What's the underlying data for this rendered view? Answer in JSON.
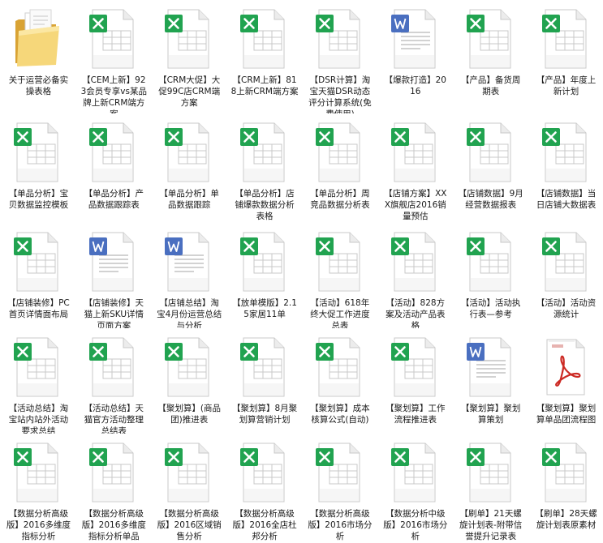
{
  "colors": {
    "excel_green": "#21a350",
    "word_blue": "#4a6fc0",
    "pdf_red": "#cc2a24",
    "page_fill": "#f2f2f2"
  },
  "files": [
    {
      "type": "folder",
      "icon": "folder-icon",
      "name": "关于运营必备实操表格"
    },
    {
      "type": "excel",
      "icon": "excel-icon",
      "name": "【CEM上新】923会员专享vs某品牌上新CRM端方案"
    },
    {
      "type": "excel",
      "icon": "excel-icon",
      "name": "【CRM大促】大促99C店CRM端方案"
    },
    {
      "type": "excel",
      "icon": "excel-icon",
      "name": "【CRM上新】818上新CRM端方案"
    },
    {
      "type": "excel",
      "icon": "excel-icon",
      "name": "【DSR计算】淘宝天猫DSR动态评分计算系统(免费使用)"
    },
    {
      "type": "word",
      "icon": "word-icon",
      "name": "【爆款打造】2016"
    },
    {
      "type": "excel",
      "icon": "excel-icon",
      "name": "【产品】备货周期表"
    },
    {
      "type": "excel",
      "icon": "excel-icon",
      "name": "【产品】年度上新计划"
    },
    {
      "type": "excel",
      "icon": "excel-icon",
      "name": "【单品分析】宝贝数据监控模板"
    },
    {
      "type": "excel",
      "icon": "excel-icon",
      "name": "【单品分析】产品数据跟踪表"
    },
    {
      "type": "excel",
      "icon": "excel-icon",
      "name": "【单品分析】单品数据跟踪"
    },
    {
      "type": "excel",
      "icon": "excel-icon",
      "name": "【单品分析】店铺爆款数据分析表格"
    },
    {
      "type": "excel",
      "icon": "excel-icon",
      "name": "【单品分析】周竞品数据分析表"
    },
    {
      "type": "excel",
      "icon": "excel-icon",
      "name": "【店铺方案】XXX旗舰店2016销量预估"
    },
    {
      "type": "excel",
      "icon": "excel-icon",
      "name": "【店铺数据】9月经营数据报表"
    },
    {
      "type": "excel",
      "icon": "excel-icon",
      "name": "【店铺数据】当日店铺大数据表"
    },
    {
      "type": "excel",
      "icon": "excel-icon",
      "name": "【店铺装修】PC首页详情面布局"
    },
    {
      "type": "word",
      "icon": "word-icon",
      "name": "【店铺装修】天猫上新SKU详情页面方案"
    },
    {
      "type": "word",
      "icon": "word-icon",
      "name": "【店铺总结】淘宝4月份运营总结与分析"
    },
    {
      "type": "excel",
      "icon": "excel-icon",
      "name": "【放单模版】2.15家居11单"
    },
    {
      "type": "excel",
      "icon": "excel-icon",
      "name": "【活动】618年终大促工作进度总表"
    },
    {
      "type": "excel",
      "icon": "excel-icon",
      "name": "【活动】828方案及活动产品表格"
    },
    {
      "type": "excel",
      "icon": "excel-icon",
      "name": "【活动】活动执行表—参考"
    },
    {
      "type": "excel",
      "icon": "excel-icon",
      "name": "【活动】活动资源统计"
    },
    {
      "type": "excel",
      "icon": "excel-icon",
      "name": "【活动总结】淘宝站内站外活动要求总结"
    },
    {
      "type": "excel",
      "icon": "excel-icon",
      "name": "【活动总结】天猫官方活动整理总结表"
    },
    {
      "type": "excel",
      "icon": "excel-icon",
      "name": "【聚划算】(商品团)推进表"
    },
    {
      "type": "excel",
      "icon": "excel-icon",
      "name": "【聚划算】8月聚划算营销计划"
    },
    {
      "type": "excel",
      "icon": "excel-icon",
      "name": "【聚划算】成本核算公式(自动)"
    },
    {
      "type": "excel",
      "icon": "excel-icon",
      "name": "【聚划算】工作流程推进表"
    },
    {
      "type": "word",
      "icon": "word-icon",
      "name": "【聚划算】聚划算策划"
    },
    {
      "type": "pdf",
      "icon": "pdf-icon",
      "name": "【聚划算】聚划算单品团流程图"
    },
    {
      "type": "excel",
      "icon": "excel-icon",
      "name": "【数据分析高级版】2016多维度指标分析"
    },
    {
      "type": "excel",
      "icon": "excel-icon",
      "name": "【数据分析高级版】2016多维度指标分析单品"
    },
    {
      "type": "excel",
      "icon": "excel-icon",
      "name": "【数据分析高级版】2016区域销售分析"
    },
    {
      "type": "excel",
      "icon": "excel-icon",
      "name": "【数据分析高级版】2016全店杜邦分析"
    },
    {
      "type": "excel",
      "icon": "excel-icon",
      "name": "【数据分析高级版】2016市场分析"
    },
    {
      "type": "excel",
      "icon": "excel-icon",
      "name": "【数据分析中级版】2016市场分析"
    },
    {
      "type": "excel",
      "icon": "excel-icon",
      "name": "【刷单】21天螺旋计划表-附带信誉提升记录表"
    },
    {
      "type": "excel",
      "icon": "excel-icon",
      "name": "【刷单】28天螺旋计划表原素材"
    }
  ]
}
